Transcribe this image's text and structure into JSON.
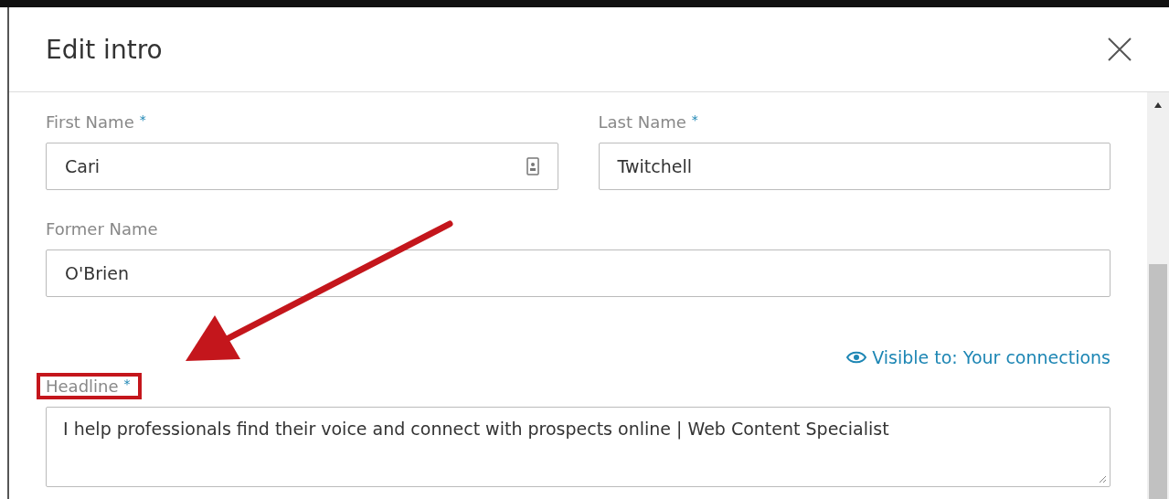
{
  "dialog": {
    "title": "Edit intro"
  },
  "fields": [
    {
      "kind": "input",
      "label": "First Name",
      "required": true,
      "value": "Cari",
      "card_icon": true,
      "highlighted": false
    },
    {
      "kind": "input",
      "label": "Last Name",
      "required": true,
      "value": "Twitchell",
      "card_icon": false,
      "highlighted": false
    },
    {
      "kind": "input",
      "label": "Former Name",
      "required": false,
      "value": "O'Brien",
      "card_icon": false,
      "highlighted": false
    },
    {
      "kind": "textarea",
      "label": "Headline",
      "required": true,
      "value": "I help professionals find their voice and connect with prospects online | Web Content Specialist",
      "card_icon": false,
      "highlighted": true
    }
  ],
  "required_mark": "*",
  "visibility_link": "Visible to: Your connections"
}
